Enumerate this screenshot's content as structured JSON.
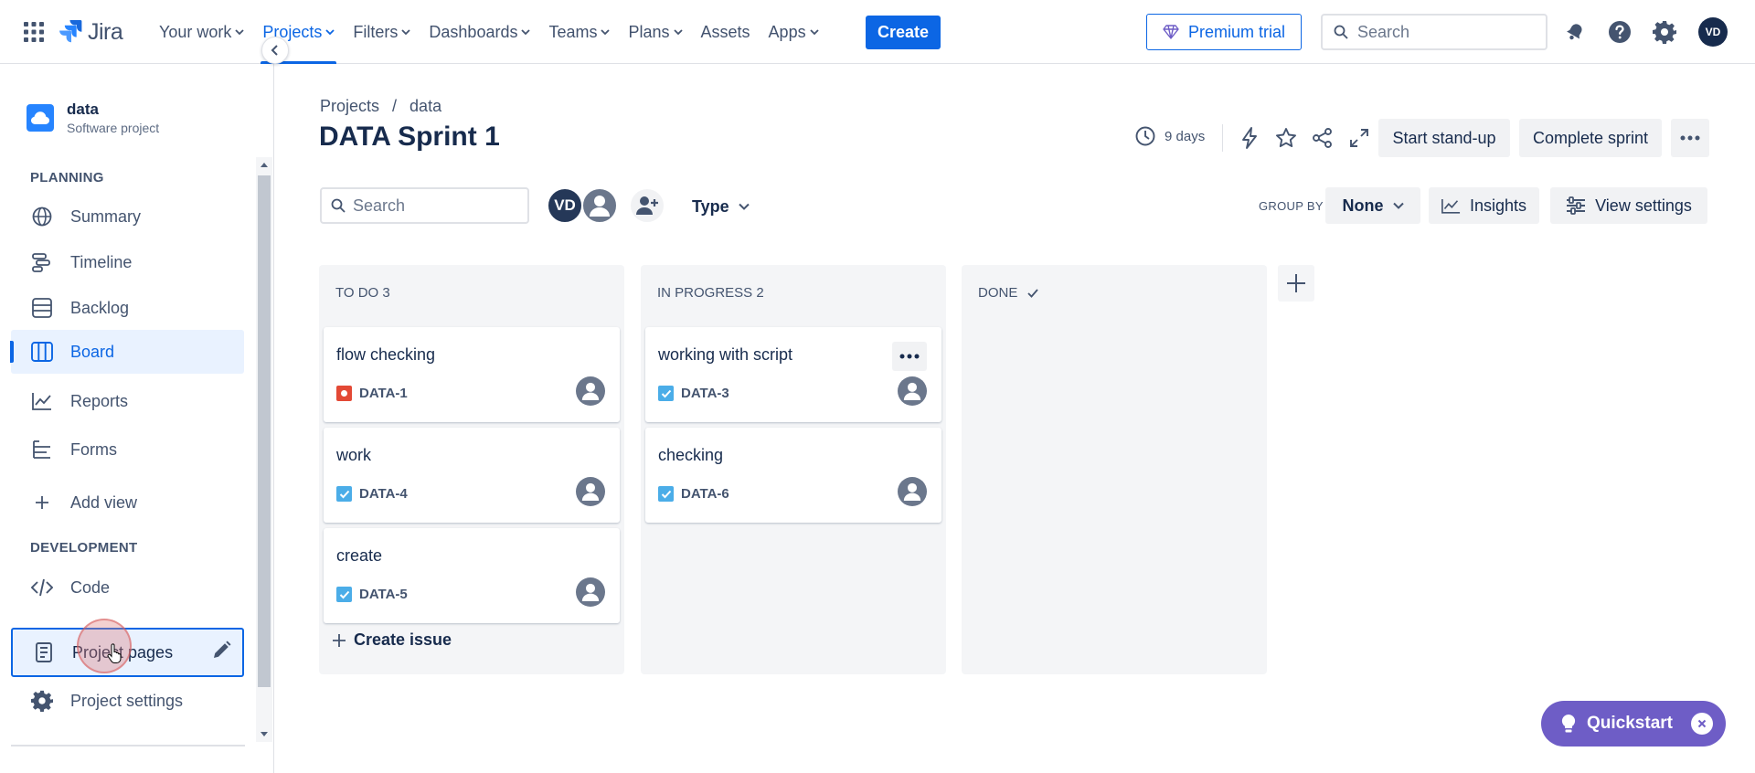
{
  "topnav": {
    "logo_text": "Jira",
    "items": [
      {
        "label": "Your work",
        "has_menu": true
      },
      {
        "label": "Projects",
        "has_menu": true,
        "active": true
      },
      {
        "label": "Filters",
        "has_menu": true
      },
      {
        "label": "Dashboards",
        "has_menu": true
      },
      {
        "label": "Teams",
        "has_menu": true
      },
      {
        "label": "Plans",
        "has_menu": true
      },
      {
        "label": "Assets",
        "has_menu": false
      },
      {
        "label": "Apps",
        "has_menu": true
      }
    ],
    "create_label": "Create",
    "premium_label": "Premium trial",
    "search_placeholder": "Search",
    "avatar_initials": "VD",
    "icons": [
      "notifications-icon",
      "help-icon",
      "settings-icon"
    ]
  },
  "sidebar": {
    "project_name": "data",
    "project_type": "Software project",
    "planning_label": "PLANNING",
    "development_label": "DEVELOPMENT",
    "items": {
      "summary": "Summary",
      "timeline": "Timeline",
      "backlog": "Backlog",
      "board": "Board",
      "reports": "Reports",
      "forms": "Forms",
      "add_view": "Add view",
      "code": "Code",
      "project_pages": "Project pages",
      "project_settings": "Project settings"
    }
  },
  "main": {
    "breadcrumb": [
      "Projects",
      "/",
      "data"
    ],
    "title": "DATA Sprint 1",
    "days_remaining": "9 days",
    "start_standup": "Start stand-up",
    "complete_sprint": "Complete sprint",
    "search_placeholder": "Search",
    "avatar_initials": "VD",
    "type_filter": "Type",
    "group_by_label": "GROUP BY",
    "group_by_value": "None",
    "insights_label": "Insights",
    "view_settings_label": "View settings"
  },
  "board": {
    "columns": [
      {
        "header": "TO DO 3",
        "cards": [
          {
            "title": "flow checking",
            "key": "DATA-1",
            "type": "bug"
          },
          {
            "title": "work",
            "key": "DATA-4",
            "type": "task"
          },
          {
            "title": "create",
            "key": "DATA-5",
            "type": "task"
          }
        ],
        "create_issue": "Create issue"
      },
      {
        "header": "IN PROGRESS 2",
        "cards": [
          {
            "title": "working with script",
            "key": "DATA-3",
            "type": "task"
          },
          {
            "title": "checking",
            "key": "DATA-6",
            "type": "task"
          }
        ]
      },
      {
        "header": "DONE",
        "cards": []
      }
    ]
  },
  "quickstart": {
    "label": "Quickstart"
  },
  "colors": {
    "brand_blue": "#0c66e4",
    "bug_red": "#e34935",
    "task_blue": "#4bade8",
    "quickstart_purple": "#6e5dc6"
  }
}
